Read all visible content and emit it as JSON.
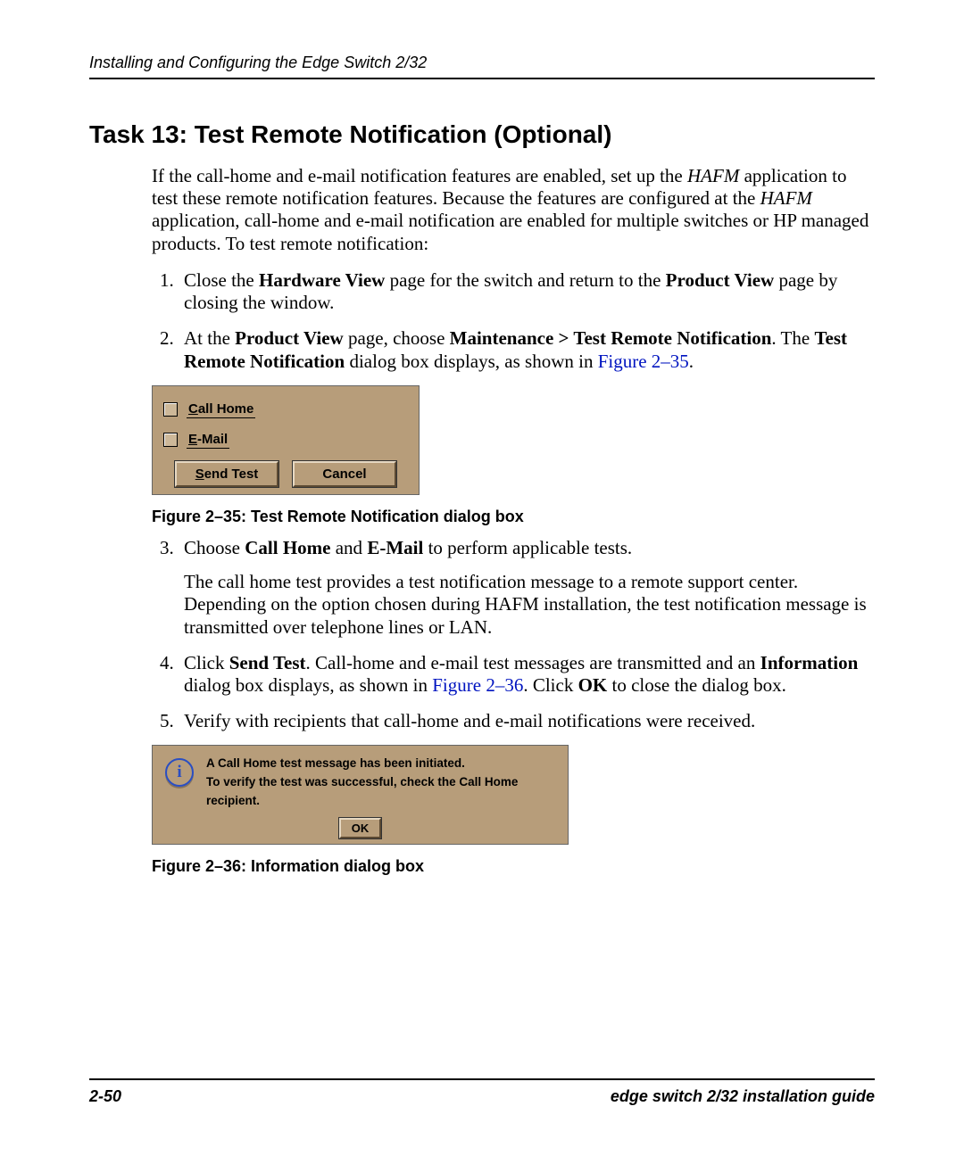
{
  "header": {
    "running": "Installing and Configuring the Edge Switch 2/32"
  },
  "title": "Task 13: Test Remote Notification (Optional)",
  "intro": {
    "p1a": "If the call-home and e-mail notification features are enabled, set up the ",
    "hafm1": "HAFM",
    "p1b": " application to test these remote notification features. Because the features are configured at the ",
    "hafm2": "HAFM",
    "p1c": " application, call-home and e-mail notification are enabled for multiple switches or HP managed products. To test remote notification:"
  },
  "steps": {
    "s1a": "Close the ",
    "s1b": "Hardware View",
    "s1c": " page for the switch and return to the ",
    "s1d": "Product View",
    "s1e": " page by closing the window.",
    "s2a": "At the ",
    "s2b": "Product View",
    "s2c": " page, choose ",
    "s2d": "Maintenance > Test Remote Notification",
    "s2e": ". The ",
    "s2f": "Test Remote Notification",
    "s2g": " dialog box displays, as shown in ",
    "s2link": "Figure 2–35",
    "s2h": ".",
    "s3a": "Choose ",
    "s3b": "Call Home",
    "s3c": " and ",
    "s3d": "E-Mail",
    "s3e": " to perform applicable tests.",
    "s3para": "The call home test provides a test notification message to a remote support center. Depending on the option chosen during HAFM installation, the test notification message is transmitted over telephone lines or LAN.",
    "s4a": "Click ",
    "s4b": "Send Test",
    "s4c": ". Call-home and e-mail test messages are transmitted and an ",
    "s4d": "Information",
    "s4e": " dialog box displays, as shown in ",
    "s4link": "Figure 2–36",
    "s4f": ". Click ",
    "s4g": "OK",
    "s4h": " to close the dialog box.",
    "s5": "Verify with recipients that call-home and e-mail notifications were received."
  },
  "fig235": {
    "opt1_pre": "C",
    "opt1_rest": "all Home",
    "opt2_pre": "E",
    "opt2_rest": "-Mail",
    "btn_send_pre": "S",
    "btn_send_rest": "end Test",
    "btn_cancel": "Cancel",
    "caption": "Figure 2–35:  Test Remote Notification dialog box"
  },
  "fig236": {
    "line1": "A Call Home test message has been initiated.",
    "line2": "To verify the test was successful, check the Call Home recipient.",
    "ok": "OK",
    "caption": "Figure 2–36:  Information dialog box"
  },
  "footer": {
    "pageno": "2-50",
    "guide": "edge switch 2/32 installation guide"
  }
}
